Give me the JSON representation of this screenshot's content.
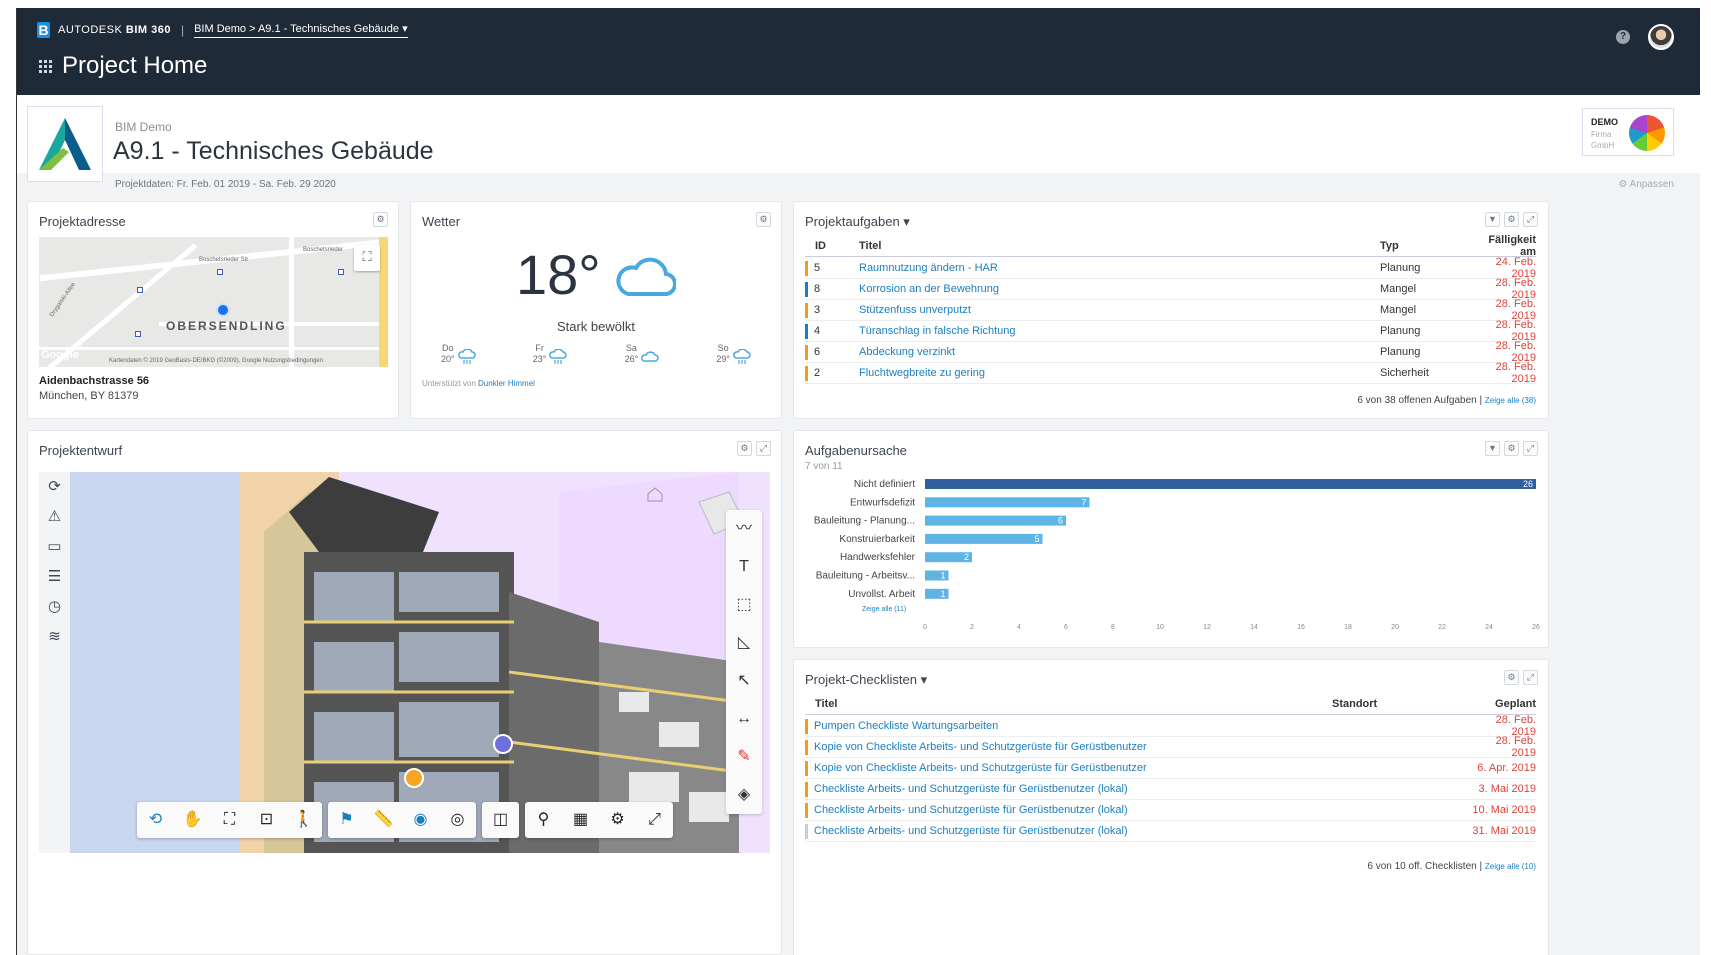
{
  "header": {
    "brand": "AUTODESK",
    "product": "BIM 360",
    "breadcrumb": "BIM Demo > A9.1 - Technisches Gebäude ▾",
    "page_title": "Project Home",
    "help": "?"
  },
  "project": {
    "account": "BIM Demo",
    "name": "A9.1 - Technisches Gebäude",
    "dates": "Projektdaten: Fr. Feb. 01 2019 - Sa. Feb. 29 2020",
    "company_logo_title": "DEMO",
    "company_logo_sub1": "Firma",
    "company_logo_sub2": "GmbH",
    "customize": "⚙ Anpassen"
  },
  "address_card": {
    "title": "Projektadresse",
    "map_district": "OBERSENDLING",
    "map_street1": "Boschetsrieder Str",
    "map_street2": "Boschetsrieder",
    "map_street3": "Drygalski-Allee",
    "map_attribution": "Kartendaten © 2019 GeoBasis-DE/BKG (©2009), Google   Nutzungsbedingungen",
    "map_google": "Google",
    "street": "Aidenbachstrasse 56",
    "city": "München, BY 81379"
  },
  "weather_card": {
    "title": "Wetter",
    "temperature": "18°",
    "description": "Stark bewölkt",
    "forecast": [
      {
        "day": "Do",
        "temp": "20°",
        "icon": "rain-cloud-icon"
      },
      {
        "day": "Fr",
        "temp": "23°",
        "icon": "rain-cloud-icon"
      },
      {
        "day": "Sa",
        "temp": "26°",
        "icon": "cloud-icon"
      },
      {
        "day": "So",
        "temp": "29°",
        "icon": "rain-cloud-icon"
      }
    ],
    "source_prefix": "Unterstützt von ",
    "source_link": "Dunkler Himmel"
  },
  "tasks_card": {
    "title": "Projektaufgaben ▾",
    "columns": [
      "ID",
      "Titel",
      "Typ",
      "Fälligkeit am"
    ],
    "rows": [
      {
        "id": "5",
        "title": "Raumnutzung ändern - HAR",
        "type": "Planung",
        "due": "24. Feb. 2019",
        "color": "#f39c12"
      },
      {
        "id": "8",
        "title": "Korrosion an der Bewehrung",
        "type": "Mangel",
        "due": "28. Feb. 2019",
        "color": "#1a7fc1"
      },
      {
        "id": "3",
        "title": "Stützenfuss unverputzt",
        "type": "Mangel",
        "due": "28. Feb. 2019",
        "color": "#f39c12"
      },
      {
        "id": "4",
        "title": "Türanschlag in falsche Richtung",
        "type": "Planung",
        "due": "28. Feb. 2019",
        "color": "#1a7fc1"
      },
      {
        "id": "6",
        "title": "Abdeckung verzinkt",
        "type": "Planung",
        "due": "28. Feb. 2019",
        "color": "#f39c12"
      },
      {
        "id": "2",
        "title": "Fluchtwegbreite zu gering",
        "type": "Sicherheit",
        "due": "28. Feb. 2019",
        "color": "#f39c12"
      }
    ],
    "footer": "6 von 38 offenen Aufgaben | ",
    "footer_link": "Zeige alle (38)"
  },
  "design_card": {
    "title": "Projektentwurf"
  },
  "cause_card": {
    "title": "Aufgabenursache",
    "subtitle": "7 von 11",
    "show_all": "Zeige alle (11)"
  },
  "checklists_card": {
    "title": "Projekt-Checklisten ▾",
    "columns": [
      "Titel",
      "Standort",
      "Geplant"
    ],
    "rows": [
      {
        "title": "Pumpen Checkliste Wartungsarbeiten",
        "due": "28. Feb. 2019",
        "color": "#f39c12"
      },
      {
        "title": "Kopie von Checkliste Arbeits- und Schutzgerüste für Gerüstbenutzer",
        "due": "28. Feb. 2019",
        "color": "#f39c12"
      },
      {
        "title": "Kopie von Checkliste Arbeits- und Schutzgerüste für Gerüstbenutzer",
        "due": "6. Apr. 2019",
        "color": "#f39c12"
      },
      {
        "title": "Checkliste Arbeits- und Schutzgerüste für Gerüstbenutzer (lokal)",
        "due": "3. Mai 2019",
        "color": "#f39c12"
      },
      {
        "title": "Checkliste Arbeits- und Schutzgerüste für Gerüstbenutzer (lokal)",
        "due": "10. Mai 2019",
        "color": "#f39c12"
      },
      {
        "title": "Checkliste Arbeits- und Schutzgerüste für Gerüstbenutzer (lokal)",
        "due": "31. Mai 2019",
        "color": "#c7ced6"
      }
    ],
    "footer": "6 von 10 off. Checklisten | ",
    "footer_link": "Zeige alle (10)"
  },
  "chart_data": {
    "type": "bar",
    "orientation": "horizontal",
    "categories": [
      "Nicht definiert",
      "Entwurfsdefizit",
      "Bauleitung - Planung...",
      "Konstruierbarkeit",
      "Handwerksfehler",
      "Bauleitung - Arbeitsv...",
      "Unvollst. Arbeit"
    ],
    "values": [
      26,
      7,
      6,
      5,
      2,
      1,
      1
    ],
    "xlim": [
      0,
      26
    ],
    "xticks": [
      0,
      2,
      4,
      6,
      8,
      10,
      12,
      14,
      16,
      18,
      20,
      22,
      24,
      26
    ],
    "colors": {
      "first": "#2f5f9e",
      "rest": "#5db4e5"
    }
  }
}
